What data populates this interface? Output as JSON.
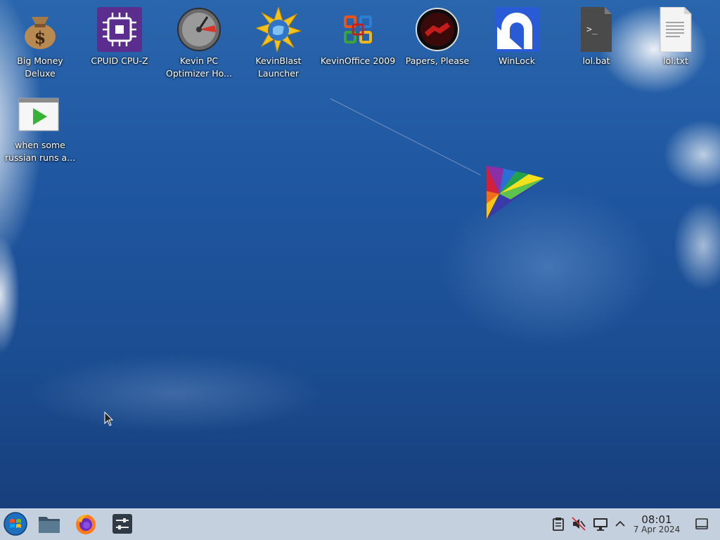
{
  "desktop": {
    "icons": [
      {
        "id": "big-money",
        "label": "Big Money Deluxe",
        "icon": "money-bag-icon"
      },
      {
        "id": "cpuz",
        "label": "CPUID CPU-Z",
        "icon": "cpu-chip-icon"
      },
      {
        "id": "kevin-pc",
        "label": "Kevin PC Optimizer Ho...",
        "icon": "speedometer-icon"
      },
      {
        "id": "kevinblast",
        "label": "KevinBlast Launcher",
        "icon": "starburst-globe-icon"
      },
      {
        "id": "kevinoffice",
        "label": "KevinOffice 2009",
        "icon": "office-logo-icon"
      },
      {
        "id": "papers",
        "label": "Papers, Please",
        "icon": "papers-please-seal-icon"
      },
      {
        "id": "winlock",
        "label": "WinLock",
        "icon": "winlock-icon"
      },
      {
        "id": "lolbat",
        "label": "lol.bat",
        "icon": "terminal-script-icon"
      },
      {
        "id": "loltxt",
        "label": "lol.txt",
        "icon": "text-file-icon"
      },
      {
        "id": "russian",
        "label": "when some russian runs a...",
        "icon": "video-file-icon"
      }
    ]
  },
  "taskbar": {
    "start": {
      "icon": "start-orb-icon"
    },
    "pinned": [
      {
        "name": "file-manager",
        "icon": "folder-icon"
      },
      {
        "name": "firefox",
        "icon": "firefox-icon"
      },
      {
        "name": "system-settings",
        "icon": "sliders-icon"
      }
    ],
    "tray": [
      {
        "name": "clipboard",
        "icon": "clipboard-icon"
      },
      {
        "name": "volume-muted",
        "icon": "speaker-muted-icon"
      },
      {
        "name": "display",
        "icon": "monitor-icon"
      },
      {
        "name": "expand-tray",
        "icon": "chevron-up-icon"
      }
    ],
    "clock": {
      "time": "08:01",
      "date": "7 Apr 2024"
    },
    "show_desktop": {
      "icon": "show-desktop-icon"
    }
  },
  "colors": {
    "taskbar_bg": "#c5d0de",
    "sky": "#1d4f94",
    "label_text": "#ffffff"
  }
}
